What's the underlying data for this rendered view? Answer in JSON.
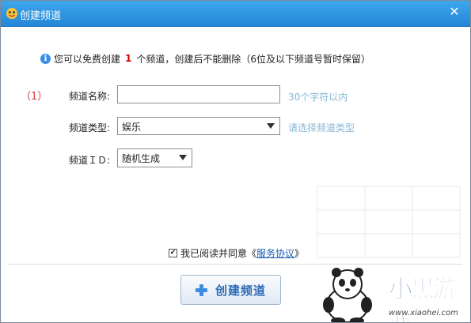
{
  "window": {
    "title": "创建频道",
    "close_glyph": "✕"
  },
  "notice": {
    "icon_glyph": "i",
    "prefix": "您可以免费创建",
    "count": "1",
    "suffix": "个频道，创建后不能删除（6位及以下频道号暂时保留）"
  },
  "form": {
    "step": "（1）",
    "name_label": "频道名称:",
    "name_value": "",
    "name_hint": "30个字符以内",
    "type_label": "频道类型:",
    "type_value": "娱乐",
    "type_hint": "请选择频道类型",
    "id_label": "频道ＩＤ:",
    "id_value": "随机生成"
  },
  "agreement": {
    "checked": true,
    "check_glyph": "✔",
    "text": "我已阅读并同意《",
    "link": "服务协议",
    "close": "》"
  },
  "button": {
    "label": "创建频道"
  },
  "watermark": {
    "logo": "小黑游戏",
    "url": "www.xiaohei.com"
  },
  "colors": {
    "titlebar": "#2a8fdc",
    "hint": "#86b8d6",
    "step": "#d34040",
    "link": "#1a5fb4",
    "button_text": "#2c6bb5"
  }
}
